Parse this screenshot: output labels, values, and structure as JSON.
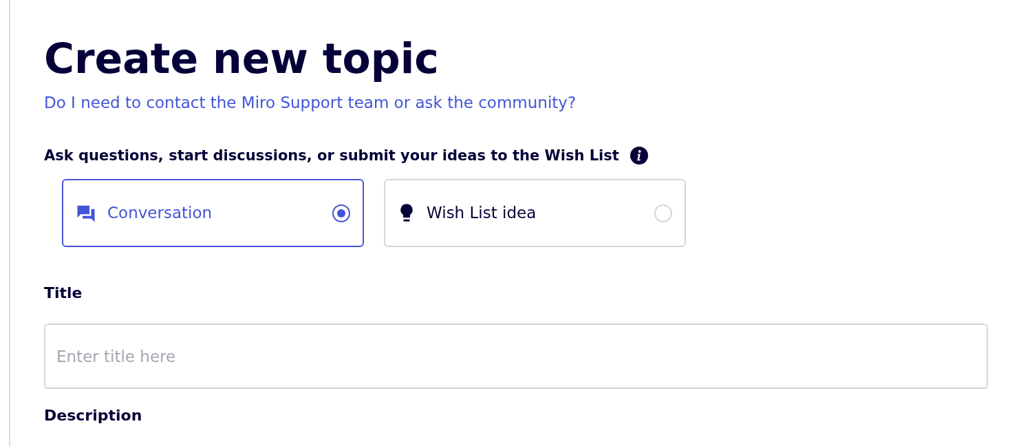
{
  "heading": "Create new topic",
  "help_link": "Do I need to contact the Miro Support team or ask the community?",
  "type_question": {
    "label": "Ask questions, start discussions, or submit your ideas to the Wish List",
    "options": [
      {
        "kind": "conversation",
        "label": "Conversation",
        "selected": true
      },
      {
        "kind": "idea",
        "label": "Wish List idea",
        "selected": false
      }
    ]
  },
  "title_field": {
    "label": "Title",
    "placeholder": "Enter title here"
  },
  "description_label": "Description"
}
